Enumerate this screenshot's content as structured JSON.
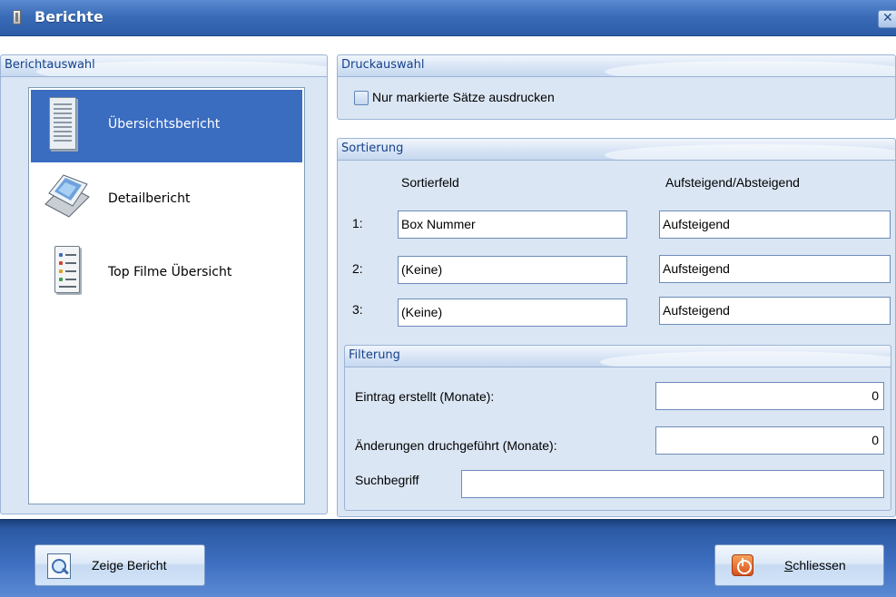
{
  "window": {
    "title": "Berichte",
    "close_icon": "close-icon"
  },
  "colors": {
    "titlebar": "#3a6cb8",
    "selection": "#3a6cc0",
    "group_bg": "#dbe6f4",
    "footer": "#3d6ec0"
  },
  "berichtauswahl": {
    "caption": "Berichtauswahl",
    "items": [
      {
        "label": "Übersichtsbericht",
        "icon": "overview-report-icon",
        "selected": true
      },
      {
        "label": "Detailbericht",
        "icon": "detail-report-icon",
        "selected": false
      },
      {
        "label": "Top  Filme Übersicht",
        "icon": "top-films-list-icon",
        "selected": false
      }
    ]
  },
  "druckauswahl": {
    "caption": "Druckauswahl",
    "checkbox_label": "Nur markierte Sätze ausdrucken",
    "checked": false
  },
  "sortierung": {
    "caption": "Sortierung",
    "col_field": "Sortierfeld",
    "col_order": "Aufsteigend/Absteigend",
    "rows": [
      {
        "num": "1:",
        "field": "Box Nummer",
        "order": "Aufsteigend"
      },
      {
        "num": "2:",
        "field": "(Keine)",
        "order": "Aufsteigend"
      },
      {
        "num": "3:",
        "field": "(Keine)",
        "order": "Aufsteigend"
      }
    ]
  },
  "filterung": {
    "caption": "Filterung",
    "eintrag_label": "Eintrag erstellt (Monate):",
    "eintrag_value": "0",
    "aenderung_label": "Änderungen druchgeführt (Monate):",
    "aenderung_value": "0",
    "such_label": "Suchbegriff",
    "such_value": ""
  },
  "footer": {
    "zeige_label": "Zeige Bericht",
    "schliessen_label": "Schliessen"
  }
}
